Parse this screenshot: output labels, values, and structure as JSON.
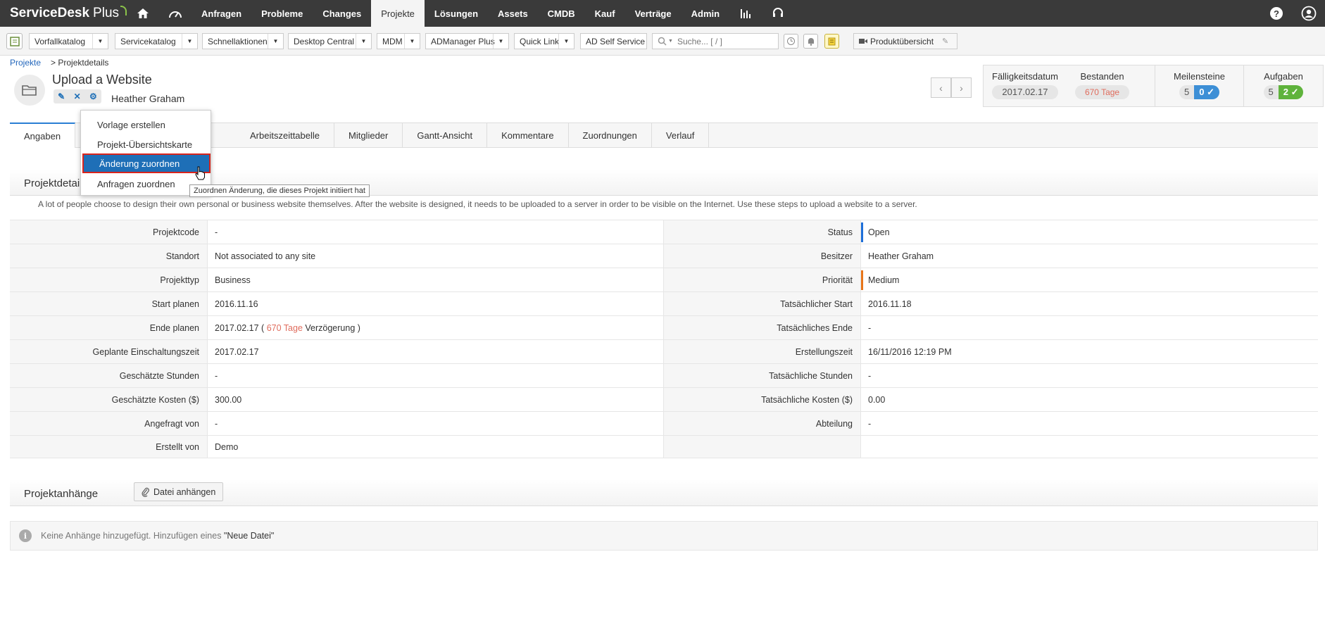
{
  "app": {
    "name_bold": "ServiceDesk",
    "name_light": "Plus"
  },
  "nav": [
    "Anfragen",
    "Probleme",
    "Changes",
    "Projekte",
    "Lösungen",
    "Assets",
    "CMDB",
    "Kauf",
    "Verträge",
    "Admin"
  ],
  "nav_active": "Projekte",
  "toolbar": {
    "dropdowns": [
      "Vorfallkatalog",
      "Servicekatalog",
      "Schnellaktionen",
      "Desktop Central",
      "MDM",
      "ADManager Plus",
      "Quick Link"
    ],
    "ad_self_service": "AD Self Service",
    "search_placeholder": "Suche... [ / ]",
    "product_overview": "Produktübersicht"
  },
  "breadcrumb": {
    "parent": "Projekte",
    "current": "> Projektdetails"
  },
  "project": {
    "title": "Upload a Website",
    "owner": "Heather Graham"
  },
  "stats": {
    "due_label": "Fälligkeitsdatum",
    "due_value": "2017.02.17",
    "exists_label": "Bestanden",
    "exists_value": "670 Tage",
    "milestones_label": "Meilensteine",
    "milestones_total": "5",
    "milestones_done": "0",
    "tasks_label": "Aufgaben",
    "tasks_total": "5",
    "tasks_done": "2"
  },
  "tabs": [
    "Angaben",
    "",
    "",
    "Arbeitszeittabelle",
    "Mitglieder",
    "Gantt-Ansicht",
    "Kommentare",
    "Zuordnungen",
    "Verlauf"
  ],
  "details": {
    "heading": "Projektdetails",
    "description": "A lot of people choose to design their own personal or business website themselves. After the website is designed, it needs to be uploaded to a server in order to be visible on the Internet. Use these steps to upload a website to a server.",
    "rows": [
      {
        "l1": "Projektcode",
        "v1": "-",
        "l2": "Status",
        "v2": "Open"
      },
      {
        "l1": "Standort",
        "v1": "Not associated to any site",
        "l2": "Besitzer",
        "v2": "Heather Graham"
      },
      {
        "l1": "Projekttyp",
        "v1": "Business",
        "l2": "Priorität",
        "v2": "Medium"
      },
      {
        "l1": "Start planen",
        "v1": "2016.11.16",
        "l2": "Tatsächlicher Start",
        "v2": "2016.11.18"
      },
      {
        "l1": "Ende planen",
        "v1": "2017.02.17 (",
        "l2": "Tatsächliches Ende",
        "v2": "-"
      },
      {
        "l1": "Geplante Einschaltungszeit",
        "v1": "2017.02.17",
        "l2": "Erstellungszeit",
        "v2": "16/11/2016 12:19 PM"
      },
      {
        "l1": "Geschätzte Stunden",
        "v1": "-",
        "l2": "Tatsächliche Stunden",
        "v2": "-"
      },
      {
        "l1": "Geschätzte Kosten ($)",
        "v1": "300.00",
        "l2": "Tatsächliche Kosten ($)",
        "v2": "0.00"
      },
      {
        "l1": "Angefragt von",
        "v1": "-",
        "l2": "Abteilung",
        "v2": "-"
      },
      {
        "l1": "Erstellt von",
        "v1": "Demo",
        "l2": "",
        "v2": ""
      }
    ],
    "delay_days": "670 Tage",
    "delay_suffix": "Verzögerung )"
  },
  "status_colors": {
    "open": "#1e6fd9",
    "medium": "#e8751a"
  },
  "attachments": {
    "heading": "Projektanhänge",
    "button": "Datei anhängen",
    "note": "Keine Anhänge hinzugefügt. Hinzufügen eines",
    "note_link": "\"Neue Datei\""
  },
  "menu": {
    "items": [
      "Vorlage erstellen",
      "Projekt-Übersichtskarte",
      "Änderung zuordnen",
      "Anfragen zuordnen"
    ],
    "tooltip": "Zuordnen Änderung, die dieses Projekt initiiert hat"
  }
}
